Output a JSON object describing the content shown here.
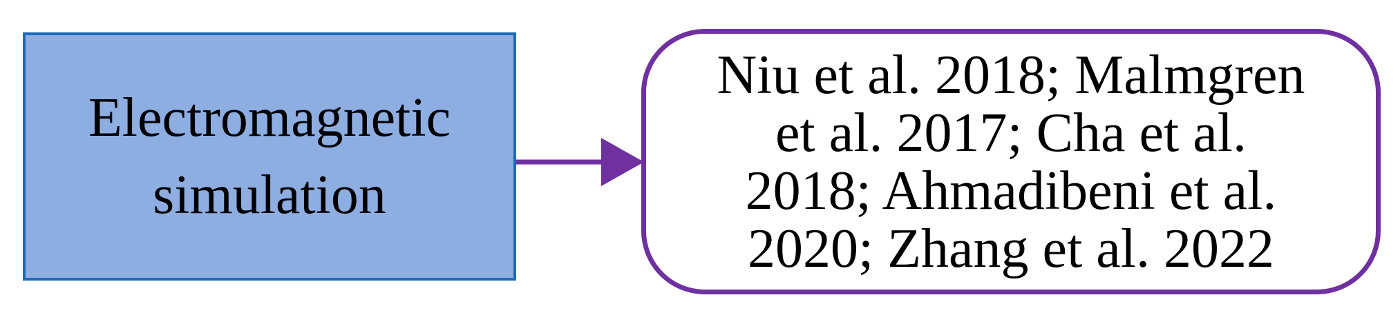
{
  "diagram": {
    "source": {
      "lines": [
        "Electromagnetic",
        "simulation"
      ]
    },
    "target": {
      "lines": [
        "Niu et al. 2018; Malmgren",
        "et al. 2017; Cha et al.",
        "2018; Ahmadibeni et al.",
        "2020; Zhang et al. 2022"
      ]
    },
    "colors": {
      "source_fill": "#8eaee2",
      "source_border": "#1c6bb8",
      "target_border": "#6f31a0",
      "arrow": "#6f31a0"
    }
  }
}
